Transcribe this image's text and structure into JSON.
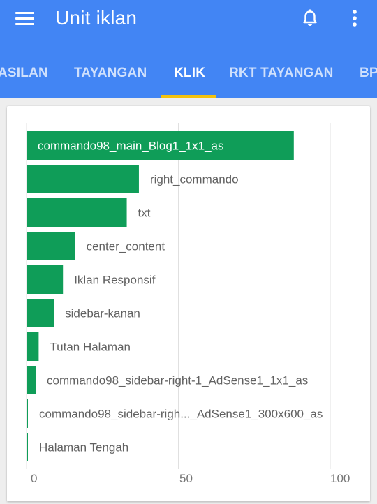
{
  "appbar": {
    "title": "Unit iklan",
    "icons": {
      "menu": "menu-icon",
      "notifications": "bell-icon",
      "more": "more-vert-icon"
    }
  },
  "tabs": [
    {
      "label": "ASILAN",
      "active": false
    },
    {
      "label": "TAYANGAN",
      "active": false
    },
    {
      "label": "KLIK",
      "active": true
    },
    {
      "label": "RKT TAYANGAN",
      "active": false
    },
    {
      "label": "BP",
      "active": false
    }
  ],
  "colors": {
    "primary": "#4285f4",
    "indicator": "#f4c20d",
    "bar": "#0f9d58"
  },
  "chart_data": {
    "type": "bar",
    "orientation": "horizontal",
    "categories": [
      "commando98_main_Blog1_1x1_as",
      "right_commando",
      "txt",
      "center_content",
      "Iklan Responsif",
      "sidebar-kanan",
      "Tutan Halaman",
      "commando98_sidebar-right-1_AdSense1_1x1_as",
      "commando98_sidebar-righ..._AdSense1_300x600_as",
      "Halaman Tengah"
    ],
    "values": [
      88,
      37,
      33,
      16,
      12,
      9,
      4,
      3,
      0.4,
      0.4
    ],
    "xlim": [
      0,
      100
    ],
    "xticks": [
      "0",
      "50",
      "100"
    ],
    "grid": true,
    "label_position": "inside-or-after-bar"
  }
}
